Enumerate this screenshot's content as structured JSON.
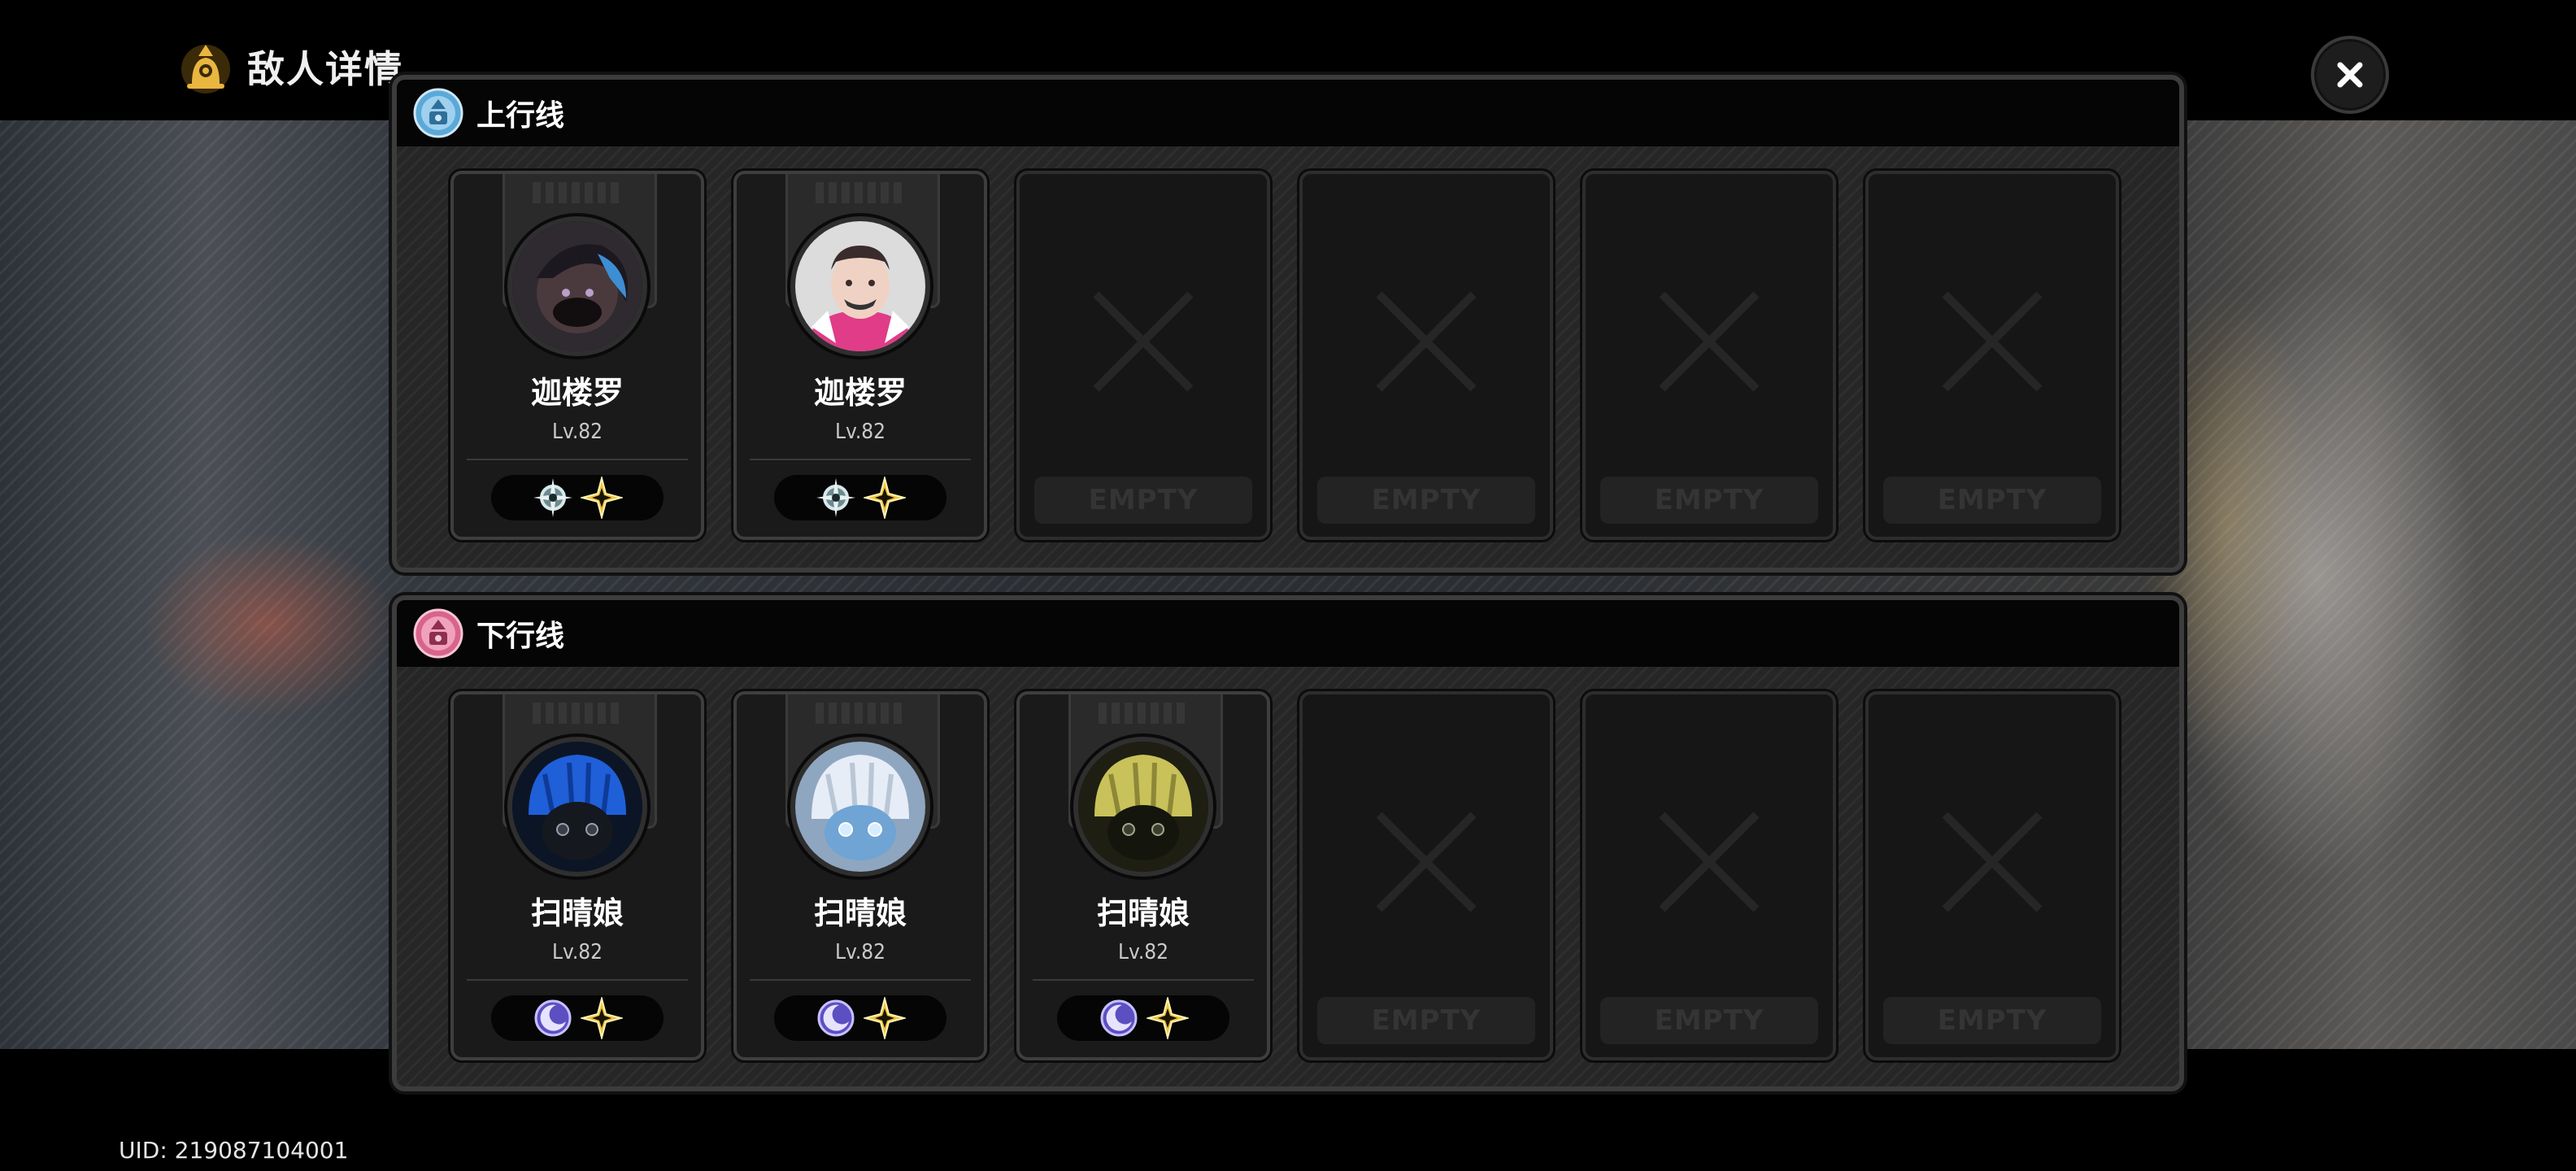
{
  "page": {
    "title": "敌人详情",
    "uid": "UID: 219087104001"
  },
  "colors": {
    "gold": "#e9b640",
    "up_line": "#5aa9d8",
    "down_line": "#d9648a"
  },
  "lines": [
    {
      "title": "上行线",
      "icon": "up-line-emblem-icon",
      "enemies": [
        {
          "name": "迦楼罗",
          "level": "Lv.82",
          "elements": [
            "wind-element-icon",
            "imaginary-element-icon"
          ]
        },
        {
          "name": "迦楼罗",
          "level": "Lv.82",
          "elements": [
            "wind-element-icon",
            "imaginary-element-icon"
          ]
        }
      ],
      "empty_slots": [
        "EMPTY",
        "EMPTY",
        "EMPTY",
        "EMPTY"
      ]
    },
    {
      "title": "下行线",
      "icon": "down-line-emblem-icon",
      "enemies": [
        {
          "name": "扫晴娘",
          "level": "Lv.82",
          "elements": [
            "quantum-element-icon",
            "imaginary-element-icon"
          ]
        },
        {
          "name": "扫晴娘",
          "level": "Lv.82",
          "elements": [
            "quantum-element-icon",
            "imaginary-element-icon"
          ]
        },
        {
          "name": "扫晴娘",
          "level": "Lv.82",
          "elements": [
            "quantum-element-icon",
            "imaginary-element-icon"
          ]
        }
      ],
      "empty_slots": [
        "EMPTY",
        "EMPTY",
        "EMPTY"
      ]
    }
  ],
  "icons": {
    "header": "enemy-bell-icon",
    "close": "close-icon"
  }
}
